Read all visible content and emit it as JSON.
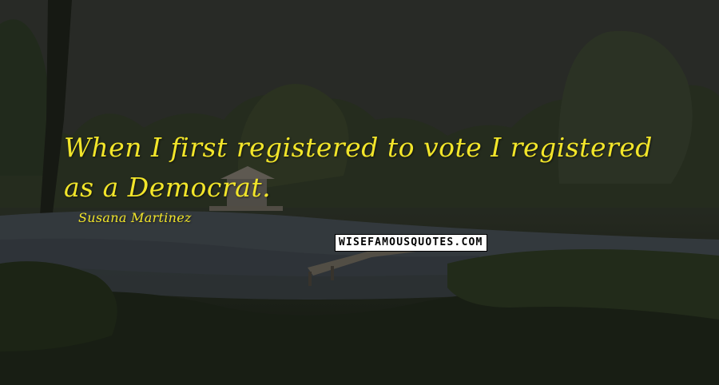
{
  "quote": {
    "text": "When I first registered to vote I registered as a Democrat.",
    "author": "Susana Martinez"
  },
  "watermark": {
    "text": "WISEFAMOUSQUOTES.COM"
  },
  "colors": {
    "quote_text": "#f2e52a",
    "watermark_bg": "#ffffff",
    "watermark_text": "#000000"
  }
}
